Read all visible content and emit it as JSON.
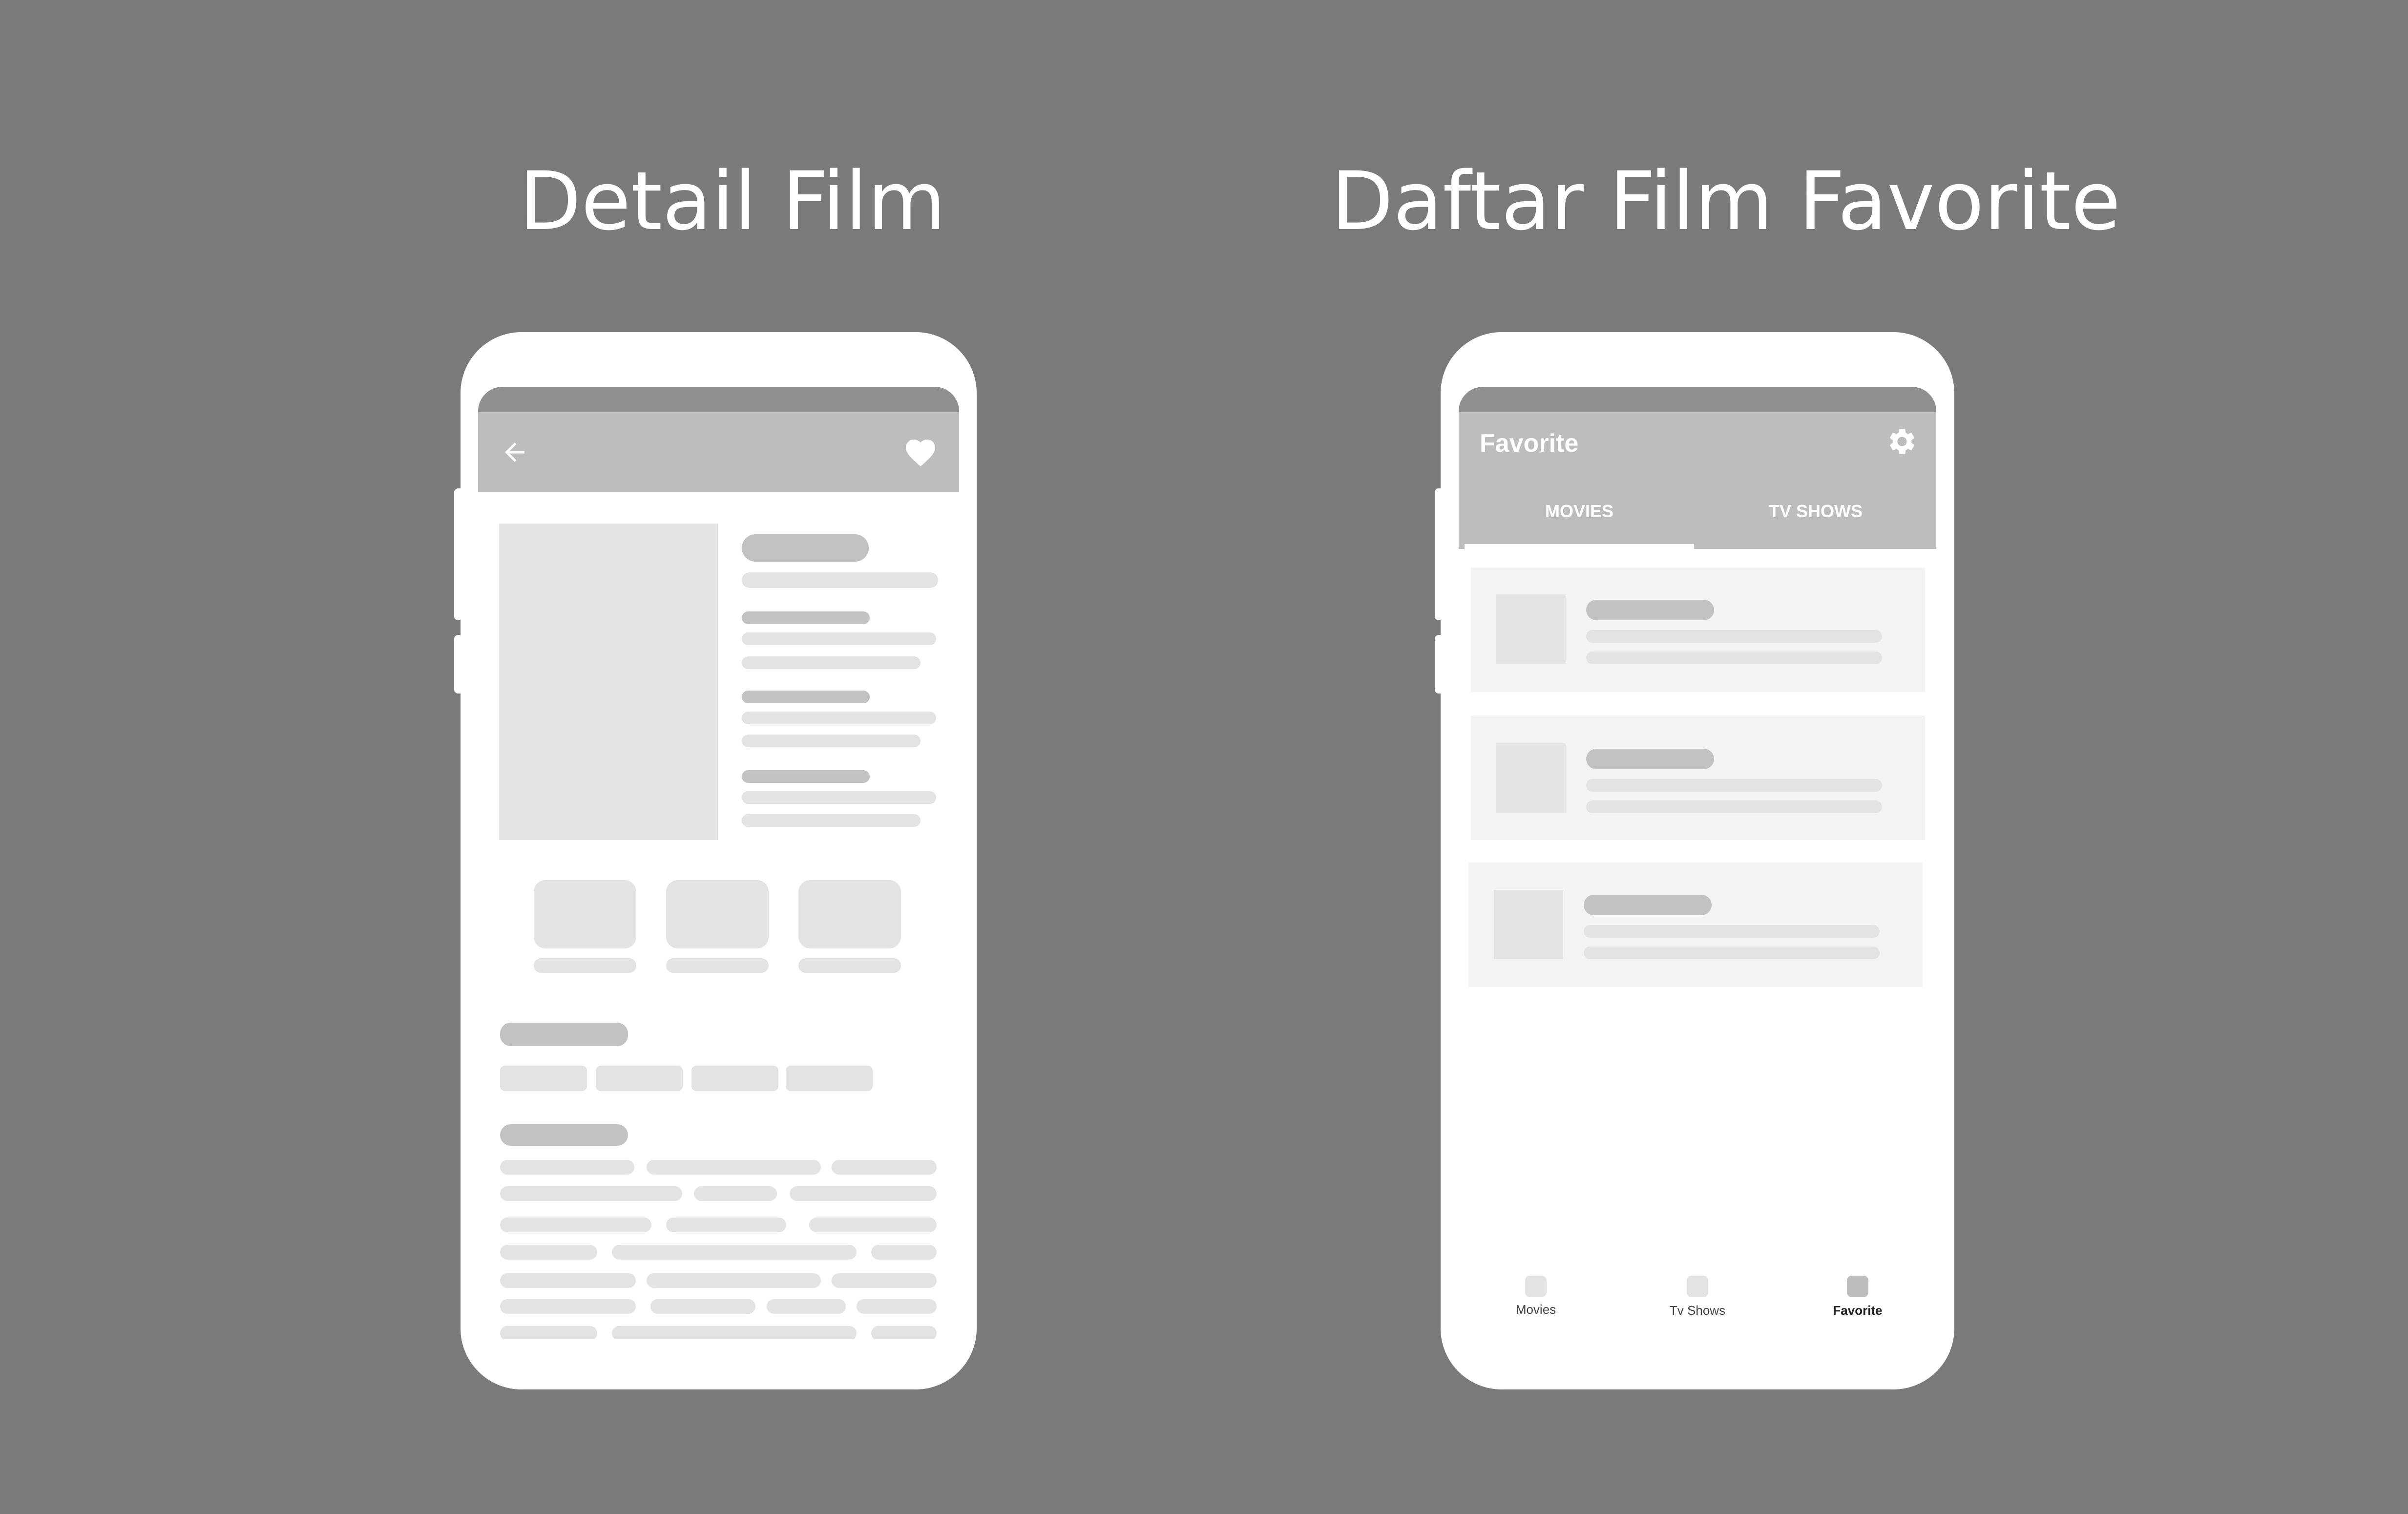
{
  "titles": {
    "detail": "Detail Film",
    "favorites": "Daftar Film Favorite"
  },
  "detail_screen": {
    "back_icon": "arrow-left-icon",
    "favorite_icon": "heart-icon"
  },
  "favorite_screen": {
    "title": "Favorite",
    "settings_icon": "gear-icon",
    "tabs": [
      "MOVIES",
      "TV SHOWS"
    ],
    "active_tab": "MOVIES",
    "nav": [
      {
        "label": "Movies"
      },
      {
        "label": "Tv Shows"
      },
      {
        "label": "Favorite",
        "active": true
      }
    ]
  },
  "colors": {
    "background": "#7a7a7a",
    "phone": "#ffffff",
    "status_bar": "#8f8f8f",
    "app_bar": "#bdbdbd",
    "placeholder_dark": "#c2c2c2",
    "placeholder_light": "#e3e3e3",
    "card": "#f3f3f3"
  }
}
